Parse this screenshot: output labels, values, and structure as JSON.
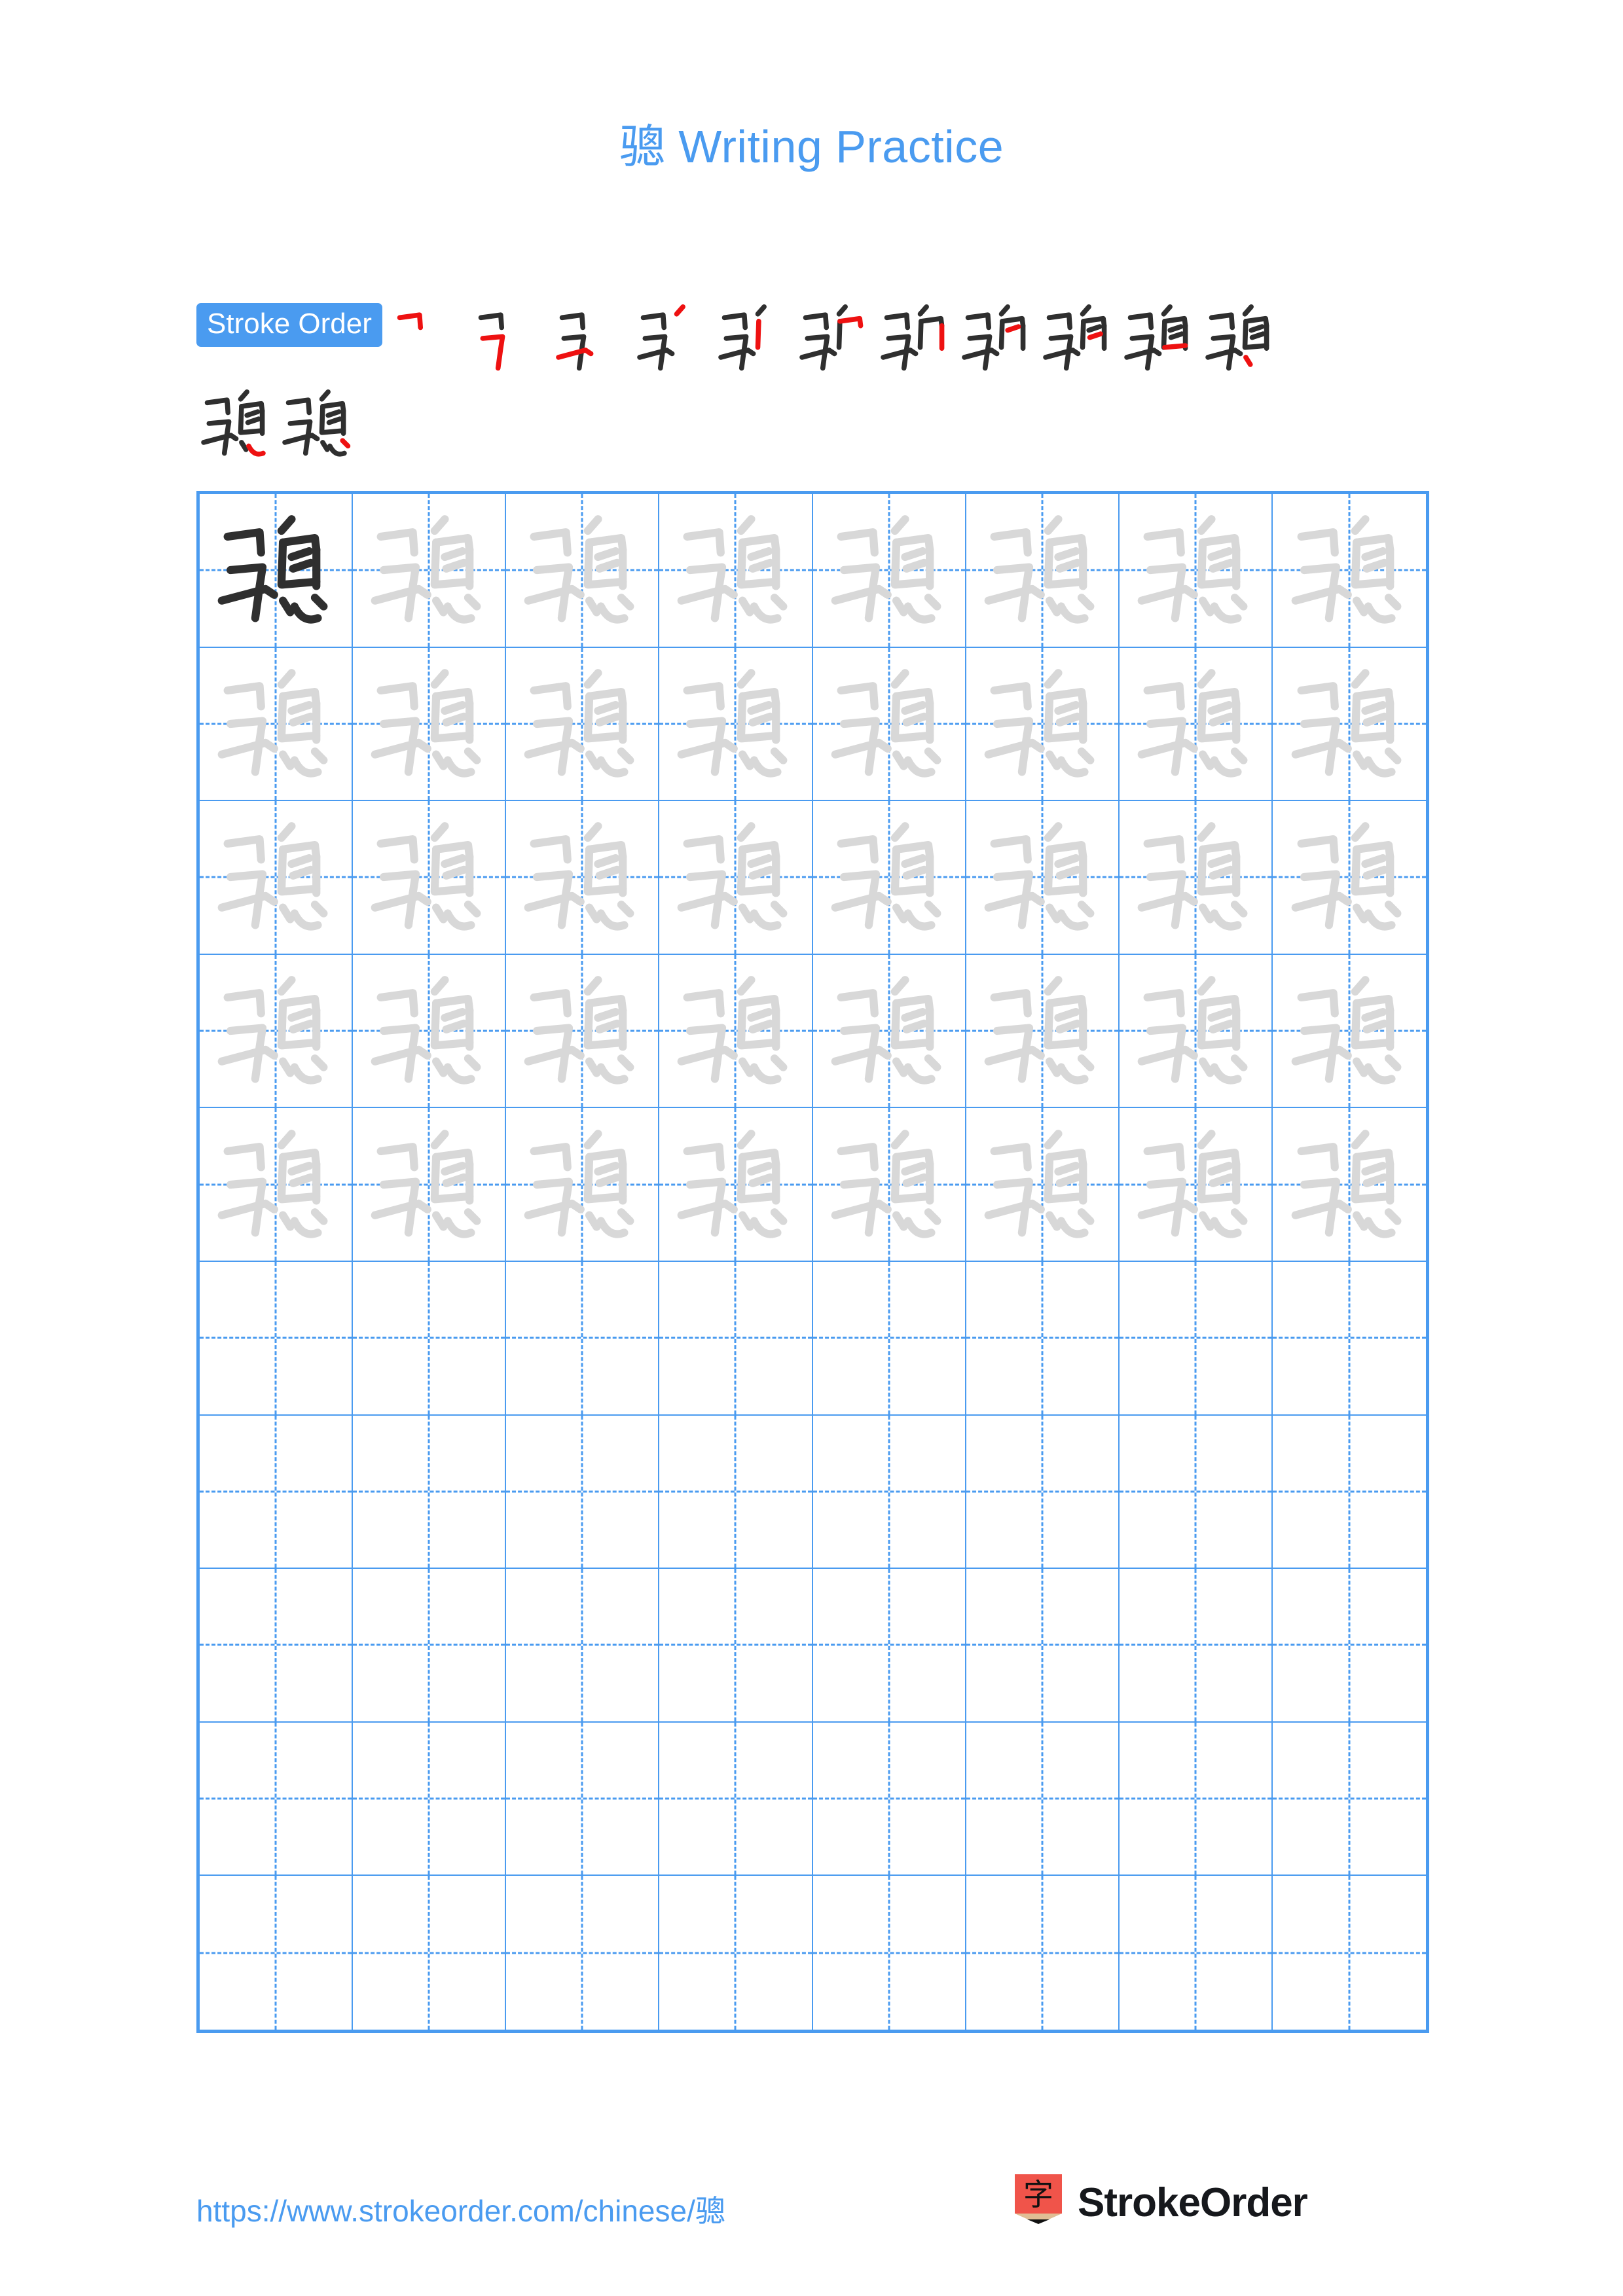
{
  "page": {
    "character": "骢",
    "title_suffix": "Writing Practice",
    "title_full": "骢 Writing Practice",
    "accent_color": "#4A9BF0",
    "new_stroke_color": "#EE1111",
    "existing_stroke_color": "#2F2F2F",
    "trace_char_color": "#D8D8D8",
    "model_char_color": "#2F2F2F",
    "background_color": "#FFFFFF"
  },
  "stroke_order": {
    "badge_label": "Stroke Order",
    "total_strokes": 13,
    "steps": [
      {
        "index": 1,
        "char": "骢",
        "strokes_drawn": 1
      },
      {
        "index": 2,
        "char": "骢",
        "strokes_drawn": 2
      },
      {
        "index": 3,
        "char": "骢",
        "strokes_drawn": 3
      },
      {
        "index": 4,
        "char": "骢",
        "strokes_drawn": 4
      },
      {
        "index": 5,
        "char": "骢",
        "strokes_drawn": 5
      },
      {
        "index": 6,
        "char": "骢",
        "strokes_drawn": 6
      },
      {
        "index": 7,
        "char": "骢",
        "strokes_drawn": 7
      },
      {
        "index": 8,
        "char": "骢",
        "strokes_drawn": 8
      },
      {
        "index": 9,
        "char": "骢",
        "strokes_drawn": 9
      },
      {
        "index": 10,
        "char": "骢",
        "strokes_drawn": 10
      },
      {
        "index": 11,
        "char": "骢",
        "strokes_drawn": 11
      },
      {
        "index": 12,
        "char": "骢",
        "strokes_drawn": 12
      },
      {
        "index": 13,
        "char": "骢",
        "strokes_drawn": 13
      }
    ],
    "row_breaks": [
      11
    ]
  },
  "practice_grid": {
    "columns": 8,
    "rows": 10,
    "filled_rows": 5,
    "empty_rows": 5,
    "model_cell": {
      "row": 1,
      "column": 1,
      "char": "骢"
    },
    "trace_char": "骢",
    "cells": [
      [
        "骢",
        "骢",
        "骢",
        "骢",
        "骢",
        "骢",
        "骢",
        "骢"
      ],
      [
        "骢",
        "骢",
        "骢",
        "骢",
        "骢",
        "骢",
        "骢",
        "骢"
      ],
      [
        "骢",
        "骢",
        "骢",
        "骢",
        "骢",
        "骢",
        "骢",
        "骢"
      ],
      [
        "骢",
        "骢",
        "骢",
        "骢",
        "骢",
        "骢",
        "骢",
        "骢"
      ],
      [
        "骢",
        "骢",
        "骢",
        "骢",
        "骢",
        "骢",
        "骢",
        "骢"
      ],
      [
        "",
        "",
        "",
        "",
        "",
        "",
        "",
        ""
      ],
      [
        "",
        "",
        "",
        "",
        "",
        "",
        "",
        ""
      ],
      [
        "",
        "",
        "",
        "",
        "",
        "",
        "",
        ""
      ],
      [
        "",
        "",
        "",
        "",
        "",
        "",
        "",
        ""
      ],
      [
        "",
        "",
        "",
        "",
        "",
        "",
        "",
        ""
      ]
    ]
  },
  "footer": {
    "url": "https://www.strokeorder.com/chinese/骢",
    "brand_name": "StrokeOrder",
    "logo_char": "字",
    "logo_color": "#F0544A"
  }
}
